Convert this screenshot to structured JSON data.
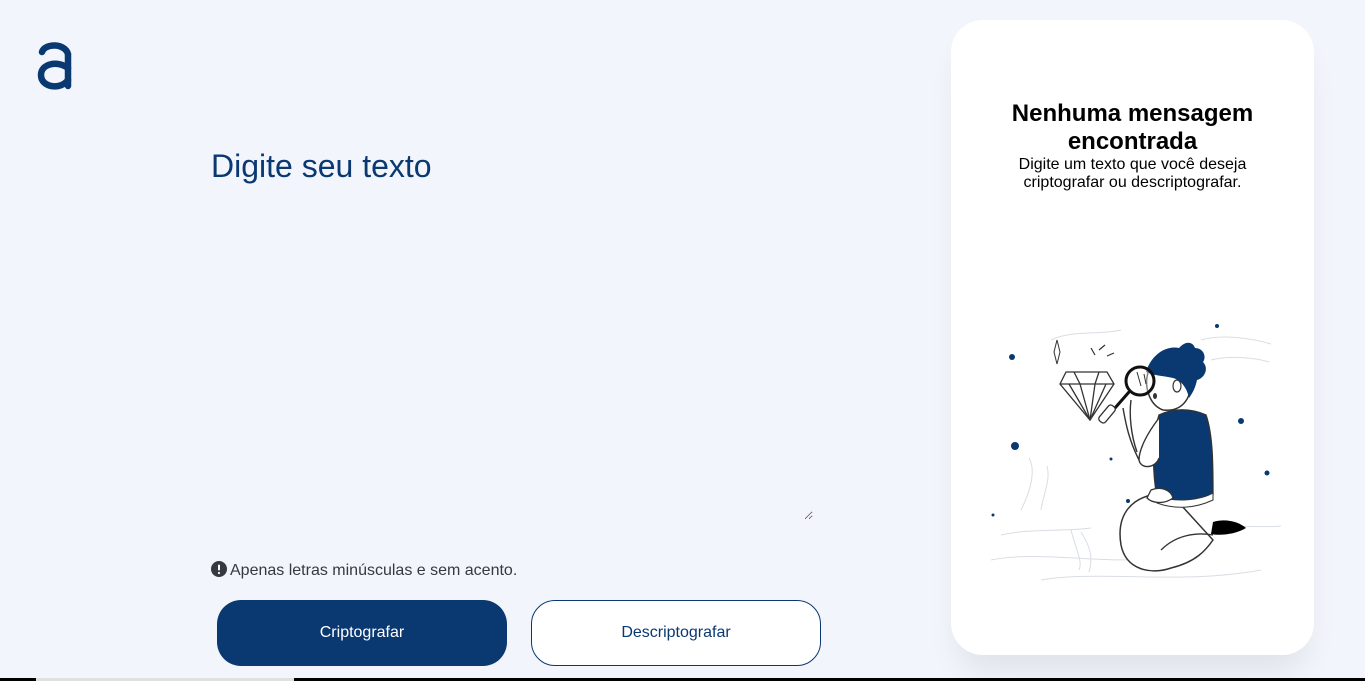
{
  "logo": {
    "icon": "alura-logo-icon",
    "color": "#0a3871"
  },
  "input": {
    "placeholder": "Digite seu texto",
    "value": ""
  },
  "hint": {
    "icon": "exclamation-circle-icon",
    "text": "Apenas letras minúsculas e sem acento."
  },
  "buttons": {
    "encrypt_label": "Criptografar",
    "decrypt_label": "Descriptografar"
  },
  "output_card": {
    "title": "Nenhuma mensagem encontrada",
    "subtitle": "Digite um texto que você deseja criptografar ou descriptografar.",
    "illustration": "person-with-magnifying-glass-illustration"
  },
  "colors": {
    "primary": "#0a3871",
    "background": "#f2f5fc",
    "card": "#ffffff",
    "hint_text": "#343a40"
  }
}
